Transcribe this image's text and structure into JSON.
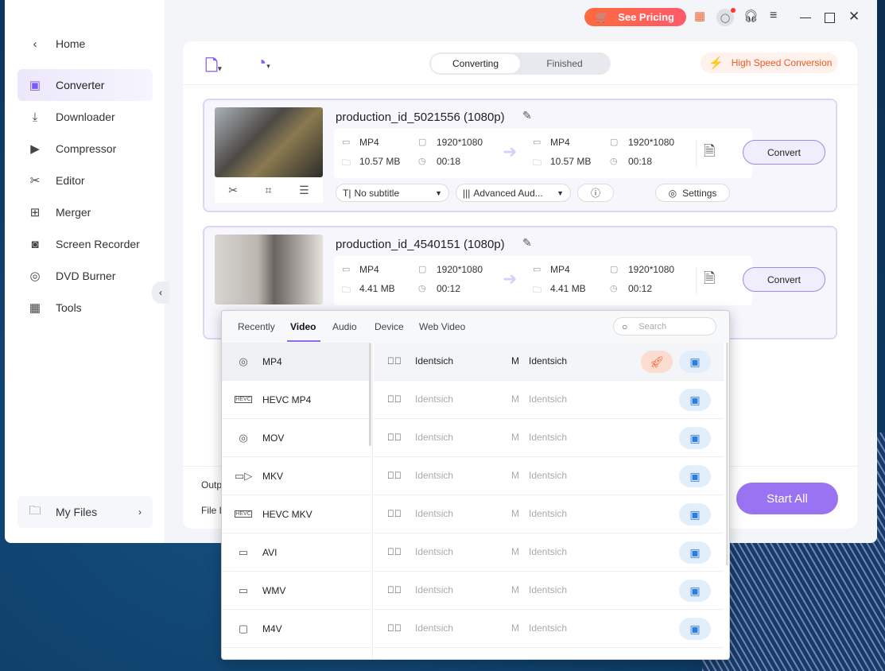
{
  "titlebar": {
    "pricing_label": "See Pricing",
    "icons": [
      "gift-icon",
      "user-icon",
      "headset-icon",
      "menu-icon",
      "minimize-icon",
      "maximize-icon",
      "close-icon"
    ]
  },
  "sidebar": {
    "home": "Home",
    "items": [
      {
        "label": "Converter",
        "icon": "converter-icon",
        "active": true
      },
      {
        "label": "Downloader",
        "icon": "download-icon"
      },
      {
        "label": "Compressor",
        "icon": "compress-icon"
      },
      {
        "label": "Editor",
        "icon": "scissors-icon"
      },
      {
        "label": "Merger",
        "icon": "merge-icon"
      },
      {
        "label": "Screen Recorder",
        "icon": "record-icon"
      },
      {
        "label": "DVD Burner",
        "icon": "disc-icon"
      },
      {
        "label": "Tools",
        "icon": "grid-icon"
      }
    ],
    "my_files": "My Files"
  },
  "toolbar": {
    "tabs": [
      "Converting",
      "Finished"
    ],
    "active_tab": "Converting",
    "high_speed": "High Speed Conversion"
  },
  "files": [
    {
      "name": "production_id_5021556 (1080p)",
      "src_format": "MP4",
      "src_res": "1920*1080",
      "src_size": "10.57 MB",
      "src_dur": "00:18",
      "dst_format": "MP4",
      "dst_res": "1920*1080",
      "dst_size": "10.57 MB",
      "dst_dur": "00:18",
      "convert": "Convert",
      "subtitle": "No subtitle",
      "audio": "Advanced Aud...",
      "settings": "Settings"
    },
    {
      "name": "production_id_4540151 (1080p)",
      "src_format": "MP4",
      "src_res": "1920*1080",
      "src_size": "4.41 MB",
      "src_dur": "00:12",
      "dst_format": "MP4",
      "dst_res": "1920*1080",
      "dst_size": "4.41 MB",
      "dst_dur": "00:12",
      "convert": "Convert"
    }
  ],
  "bottom": {
    "output_label": "Outp",
    "file_location_label": "File L",
    "start_all": "Start All"
  },
  "format_popup": {
    "tabs": [
      "Recently",
      "Video",
      "Audio",
      "Device",
      "Web Video"
    ],
    "active_tab": "Video",
    "search_placeholder": "Search",
    "formats": [
      "MP4",
      "HEVC MP4",
      "MOV",
      "MKV",
      "HEVC MKV",
      "AVI",
      "WMV",
      "M4V"
    ],
    "selected_format": "MP4",
    "presets": [
      {
        "res": "Identsich",
        "size": "M",
        "quality": "Identsich"
      },
      {
        "res": "Identsich",
        "size": "M",
        "quality": "Identsich"
      },
      {
        "res": "Identsich",
        "size": "M",
        "quality": "Identsich"
      },
      {
        "res": "Identsich",
        "size": "M",
        "quality": "Identsich"
      },
      {
        "res": "Identsich",
        "size": "M",
        "quality": "Identsich"
      },
      {
        "res": "Identsich",
        "size": "M",
        "quality": "Identsich"
      },
      {
        "res": "Identsich",
        "size": "M",
        "quality": "Identsich"
      },
      {
        "res": "Identsich",
        "size": "M",
        "quality": "Identsich"
      }
    ]
  },
  "colors": {
    "accent": "#8b6cf0",
    "pricing": "#ff6a3d",
    "hw_accel": "#2a7de1"
  }
}
